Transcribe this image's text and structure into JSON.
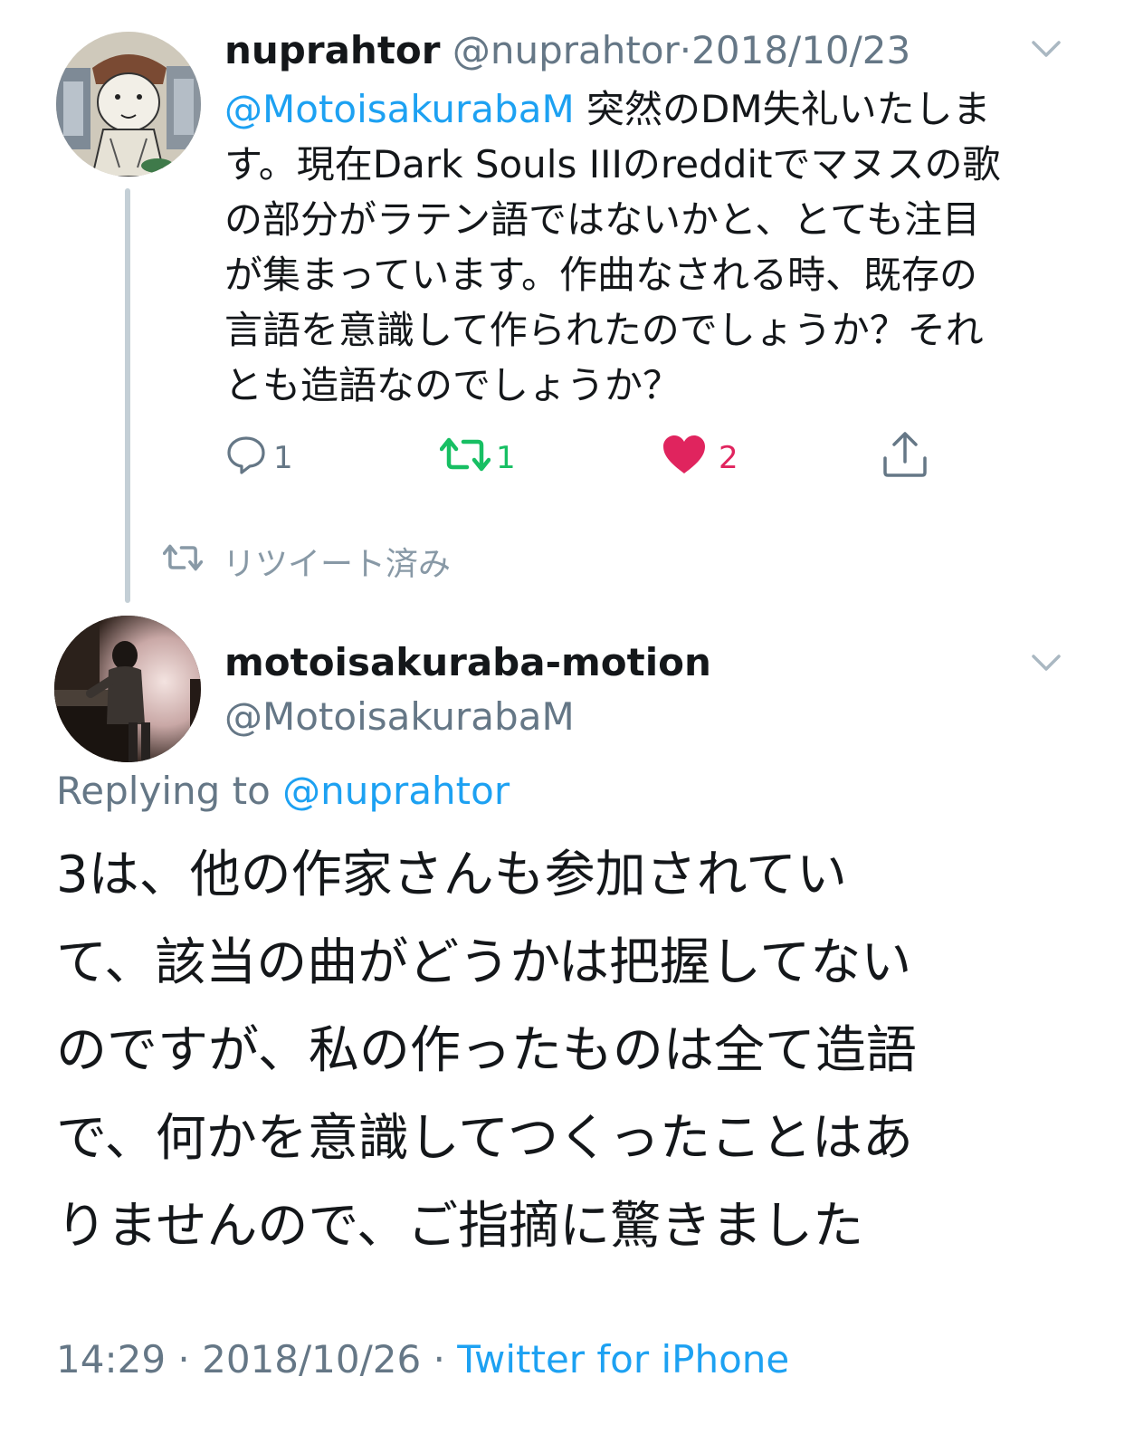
{
  "parent_tweet": {
    "display_name": "nuprahtor",
    "handle": "@nuprahtor",
    "separator": "·",
    "date": "2018/10/23",
    "mention": "@MotoisakurabaM",
    "body_text": " 突然のDM失礼いたしま\nす。現在Dark Souls IIIのredditでマヌスの歌\nの部分がラテン語ではないかと、とても注目\nが集まっています。作曲なされる時、既存の\n言語を意識して作られたのでしょうか？それ\nとも造語なのでしょうか？",
    "reply_count": "1",
    "retweet_count": "1",
    "like_count": "2",
    "colors": {
      "retweet": "#17bf63",
      "like": "#e0245e",
      "link": "#1da1f2"
    }
  },
  "retweeted_label": "リツイート済み",
  "reply_tweet": {
    "display_name": "motoisakuraba-motion",
    "handle": "@MotoisakurabaM",
    "replying_to_label": "Replying to",
    "replying_to_handle": "@nuprahtor",
    "body_text": "3は、他の作家さんも参加されてい\nて、該当の曲がどうかは把握してない\nのですが、私の作ったものは全て造語\nで、何かを意識してつくったことはあ\nりませんので、ご指摘に驚きました",
    "time": "14:29",
    "date": "2018/10/26",
    "separator": "·",
    "source": "Twitter for iPhone"
  },
  "icons": {
    "reply": "reply-bubble-icon",
    "retweet": "retweet-arrows-icon",
    "like": "heart-icon",
    "share": "share-upload-icon",
    "menu": "chevron-down-icon"
  }
}
